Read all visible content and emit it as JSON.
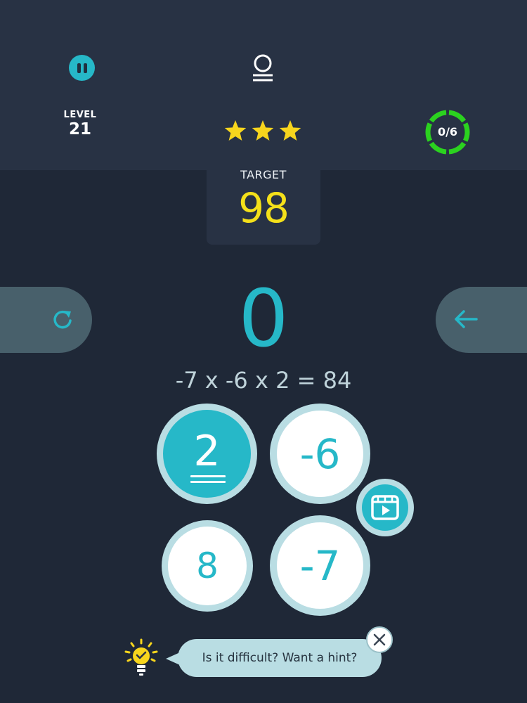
{
  "header": {
    "pause_icon": "pause-icon",
    "coin_icon": "coin-stack-icon",
    "level_label": "LEVEL",
    "level_value": "21",
    "stars_earned": 3,
    "stars_total": 3,
    "progress_text": "0/6",
    "progress_fraction": 0,
    "progress_color": "#2bd21f"
  },
  "target": {
    "label": "TARGET",
    "value": "98"
  },
  "controls": {
    "restart_icon": "restart-icon",
    "back_icon": "arrow-left-icon"
  },
  "result": {
    "value": "0",
    "equation": "-7 x -6 x 2 = 84"
  },
  "tiles": [
    {
      "value": "2",
      "selected": true
    },
    {
      "value": "-6",
      "selected": false
    },
    {
      "value": "8",
      "selected": false
    },
    {
      "value": "-7",
      "selected": false
    }
  ],
  "video_button_icon": "video-play-icon",
  "hint": {
    "text": "Is it difficult? Want a hint?",
    "bulb_icon": "lightbulb-icon",
    "close_icon": "close-icon"
  },
  "colors": {
    "background": "#1f2837",
    "panel": "#283244",
    "accent": "#26b8c8",
    "target": "#f4e01a",
    "star": "#f7d51d",
    "tile_ring": "#b9dde3"
  }
}
